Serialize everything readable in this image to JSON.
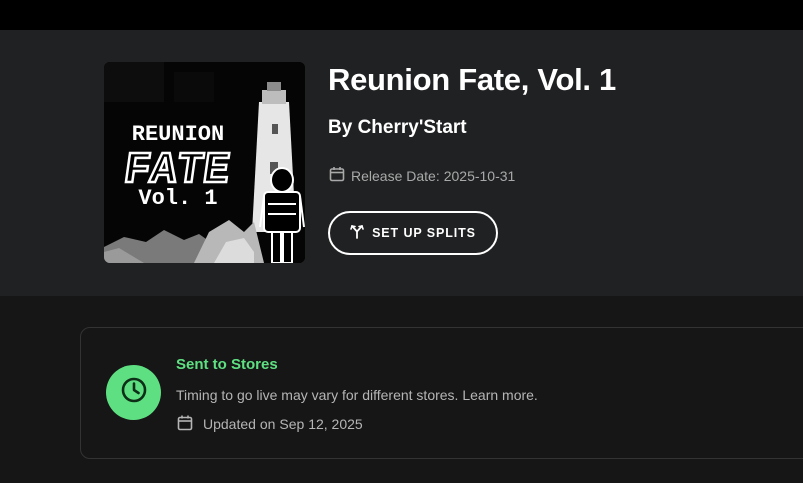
{
  "release": {
    "title": "Reunion Fate, Vol. 1",
    "artist_label": "By Cherry'Start",
    "release_date_label": "Release Date:",
    "release_date": "2025-10-31",
    "splits_button": "SET UP SPLITS",
    "cover_art": {
      "title_line1": "REUNION",
      "title_line2": "FATE",
      "title_line3": "Vol. 1"
    }
  },
  "status": {
    "title": "Sent to Stores",
    "description": "Timing to go live may vary for different stores.",
    "learn_more": "Learn more.",
    "updated_label": "Updated on",
    "updated_date": "Sep 12, 2025",
    "icon": "clock-icon"
  },
  "colors": {
    "accent_green": "#5ee082",
    "hero_bg": "#202122",
    "page_bg": "#161616"
  }
}
